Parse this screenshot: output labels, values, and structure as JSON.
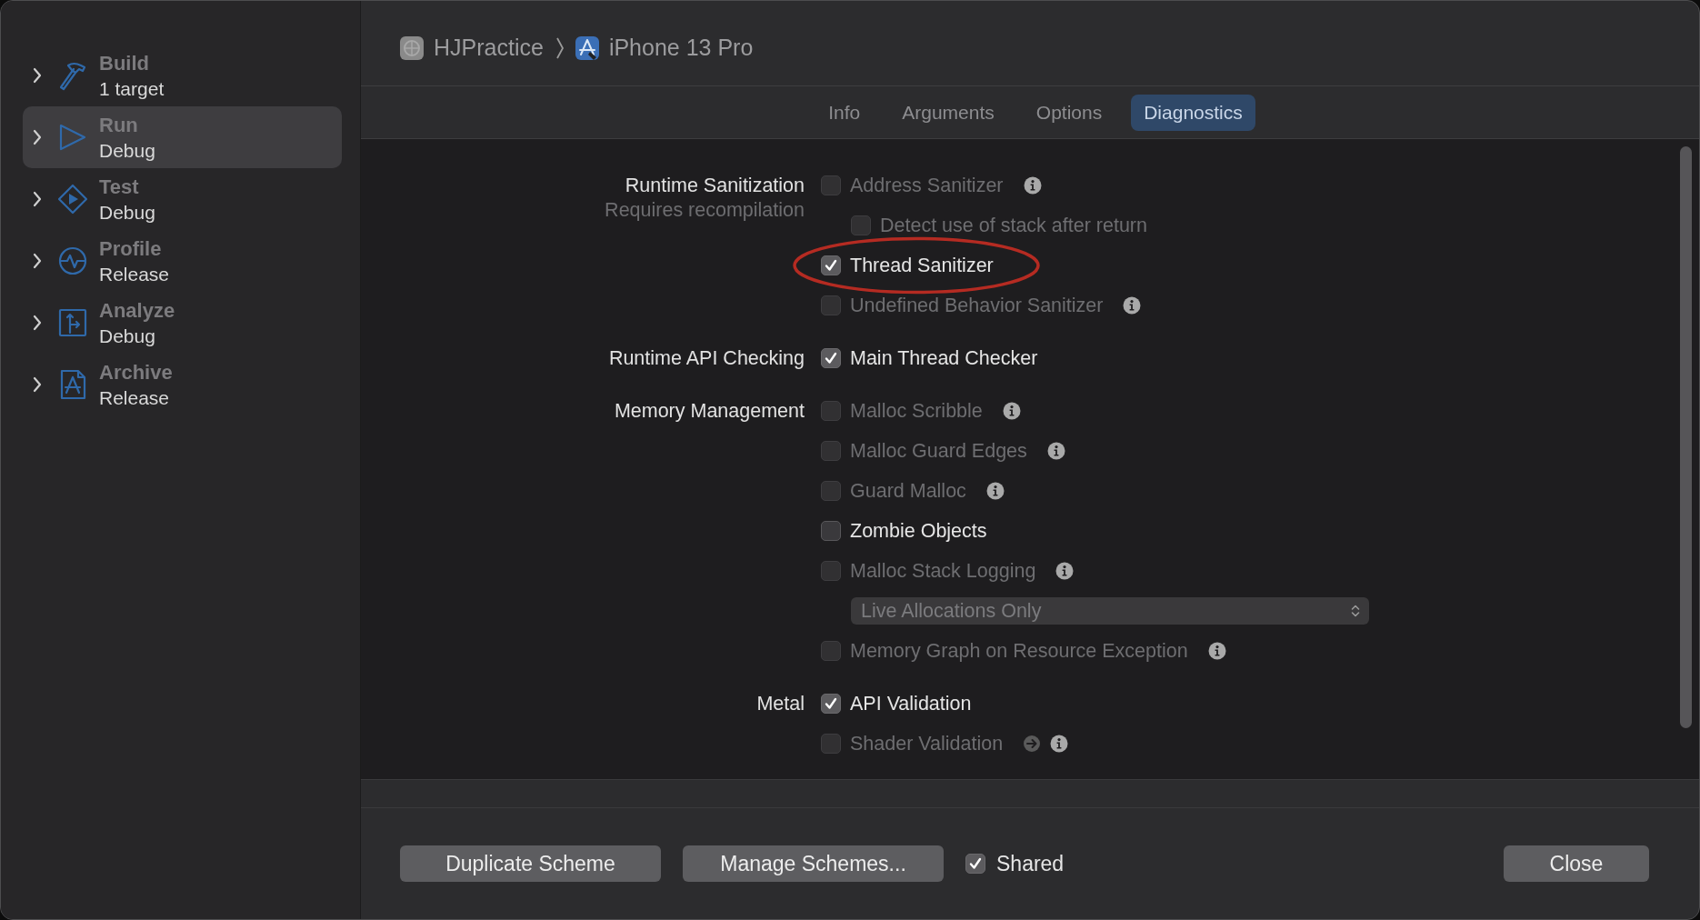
{
  "sidebar": {
    "items": [
      {
        "title": "Build",
        "subtitle": "1 target",
        "kind": "build",
        "selected": false
      },
      {
        "title": "Run",
        "subtitle": "Debug",
        "kind": "run",
        "selected": true
      },
      {
        "title": "Test",
        "subtitle": "Debug",
        "kind": "test",
        "selected": false
      },
      {
        "title": "Profile",
        "subtitle": "Release",
        "kind": "profile",
        "selected": false
      },
      {
        "title": "Analyze",
        "subtitle": "Debug",
        "kind": "analyze",
        "selected": false
      },
      {
        "title": "Archive",
        "subtitle": "Release",
        "kind": "archive",
        "selected": false
      }
    ]
  },
  "breadcrumb": {
    "project": "HJPractice",
    "destination": "iPhone 13 Pro"
  },
  "tabs": [
    {
      "label": "Info",
      "selected": false
    },
    {
      "label": "Arguments",
      "selected": false
    },
    {
      "label": "Options",
      "selected": false
    },
    {
      "label": "Diagnostics",
      "selected": true
    }
  ],
  "sections": [
    {
      "label": "Runtime Sanitization",
      "sublabel": "Requires recompilation",
      "options": [
        {
          "kind": "checkbox",
          "label": "Address Sanitizer",
          "checked": false,
          "disabled": true,
          "info": true,
          "children": [
            {
              "kind": "checkbox",
              "label": "Detect use of stack after return",
              "checked": false,
              "disabled": true
            }
          ]
        },
        {
          "kind": "checkbox",
          "label": "Thread Sanitizer",
          "checked": true,
          "disabled": false,
          "circled": true
        },
        {
          "kind": "checkbox",
          "label": "Undefined Behavior Sanitizer",
          "checked": false,
          "disabled": true,
          "info": true
        }
      ]
    },
    {
      "label": "Runtime API Checking",
      "options": [
        {
          "kind": "checkbox",
          "label": "Main Thread Checker",
          "checked": true,
          "disabled": false
        }
      ]
    },
    {
      "label": "Memory Management",
      "options": [
        {
          "kind": "checkbox",
          "label": "Malloc Scribble",
          "checked": false,
          "disabled": true,
          "info": true
        },
        {
          "kind": "checkbox",
          "label": "Malloc Guard Edges",
          "checked": false,
          "disabled": true,
          "info": true
        },
        {
          "kind": "checkbox",
          "label": "Guard Malloc",
          "checked": false,
          "disabled": true,
          "info": true
        },
        {
          "kind": "checkbox",
          "label": "Zombie Objects",
          "checked": false,
          "disabled": false
        },
        {
          "kind": "checkbox",
          "label": "Malloc Stack Logging",
          "checked": false,
          "disabled": true,
          "info": true,
          "children": [
            {
              "kind": "popup",
              "value": "Live Allocations Only",
              "disabled": true
            }
          ]
        },
        {
          "kind": "checkbox",
          "label": "Memory Graph on Resource Exception",
          "checked": false,
          "disabled": true,
          "info": true
        }
      ]
    },
    {
      "label": "Metal",
      "options": [
        {
          "kind": "checkbox",
          "label": "API Validation",
          "checked": true,
          "disabled": false
        },
        {
          "kind": "checkbox",
          "label": "Shader Validation",
          "checked": false,
          "disabled": true,
          "arrow": true,
          "info": true
        }
      ]
    }
  ],
  "footer": {
    "buttons": [
      "Duplicate Scheme",
      "Manage Schemes..."
    ],
    "shared": {
      "label": "Shared",
      "checked": true
    },
    "close": "Close"
  }
}
